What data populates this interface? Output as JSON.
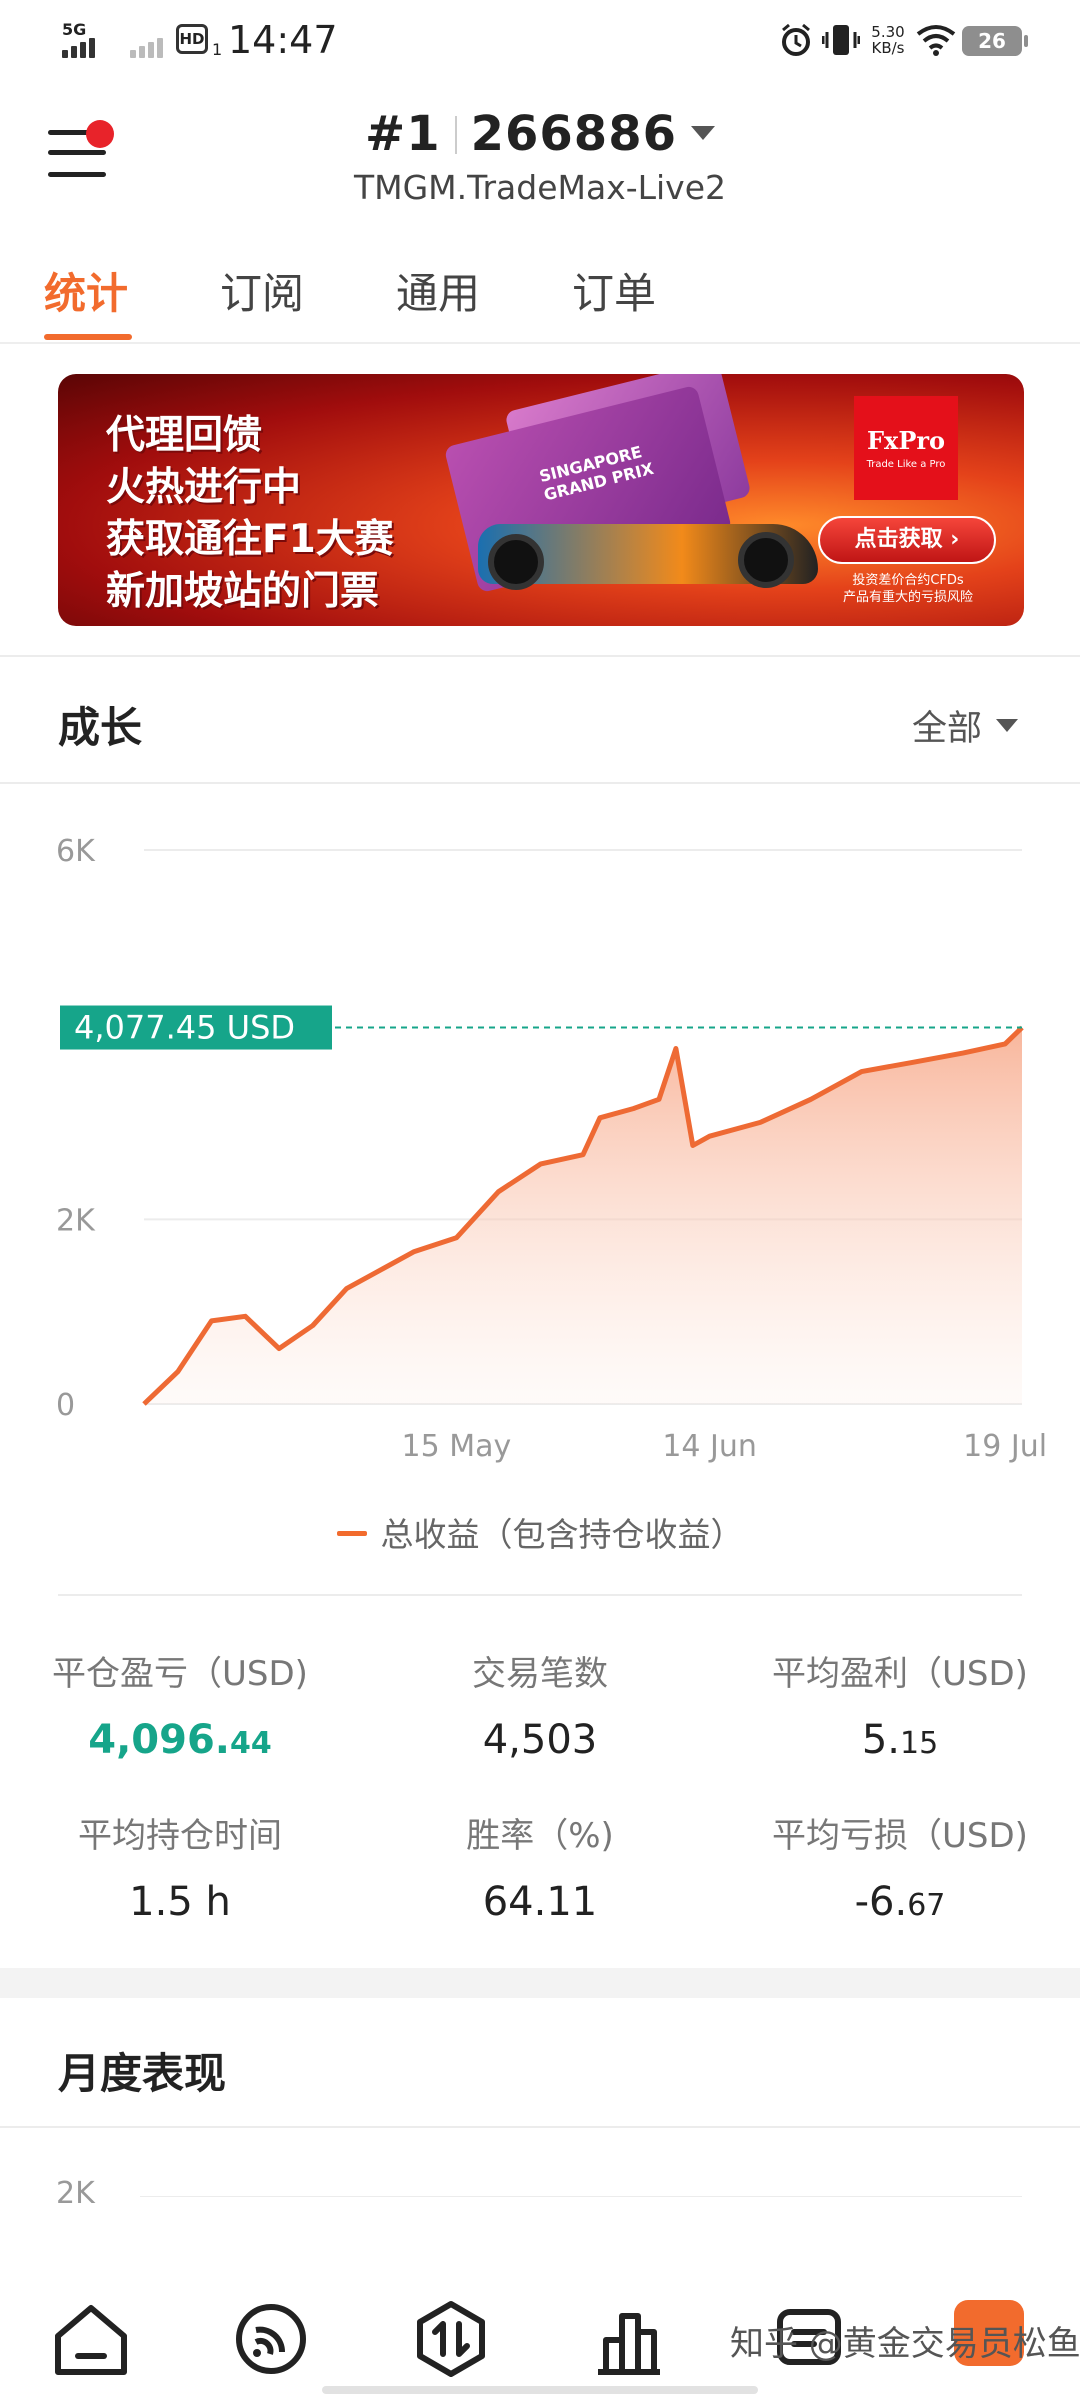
{
  "status_bar": {
    "network": "5G",
    "hd": "HD",
    "hd_sub": "1",
    "time": "14:47",
    "net_speed_value": "5.30",
    "net_speed_unit": "KB/s",
    "battery": "26"
  },
  "header": {
    "rank": "#1",
    "account_id": "266886",
    "server": "TMGM.TradeMax-Live2"
  },
  "tabs": [
    "统计",
    "订阅",
    "通用",
    "订单"
  ],
  "banner": {
    "lines": [
      "代理回馈",
      "火热进行中",
      "获取通往F1大赛",
      "新加坡站的门票"
    ],
    "brand": "FxPro",
    "brand_tagline": "Trade Like a Pro",
    "ticket_text": "SINGAPORE GRAND PRIX",
    "cta": "点击获取",
    "disclaimer_1": "投资差价合约CFDs",
    "disclaimer_2": "产品有重大的亏损风险"
  },
  "growth": {
    "title": "成长",
    "range": "全部",
    "current_value_label": "4,077.45  USD",
    "legend": "总收益（包含持仓收益）"
  },
  "chart_data": {
    "type": "area",
    "y_ticks": [
      "0",
      "2K",
      "6K"
    ],
    "x_ticks": [
      "15  May",
      "14  Jun",
      "19  Jul"
    ],
    "ylim": [
      0,
      6000
    ],
    "current_value": 4077.45,
    "x": [
      "Apr 8",
      "Apr 12",
      "Apr 16",
      "Apr 20",
      "Apr 24",
      "Apr 28",
      "May 2",
      "May 6",
      "May 10",
      "May 15",
      "May 20",
      "May 25",
      "May 30",
      "Jun 1",
      "Jun 5",
      "Jun 8",
      "Jun 10",
      "Jun 12",
      "Jun 14",
      "Jun 20",
      "Jun 26",
      "Jul 2",
      "Jul 8",
      "Jul 14",
      "Jul 19",
      "Jul 21"
    ],
    "series": [
      {
        "values": [
          0,
          350,
          900,
          950,
          600,
          850,
          1250,
          1450,
          1650,
          1800,
          2300,
          2600,
          2700,
          3100,
          3200,
          3300,
          3850,
          2800,
          2900,
          3050,
          3300,
          3600,
          3700,
          3800,
          3900,
          4077
        ]
      }
    ]
  },
  "stats": [
    {
      "label": "平仓盈亏（USD)",
      "value_main": "4,096.",
      "value_dec": "44",
      "style": "green"
    },
    {
      "label": "交易笔数",
      "value_main": "4,503",
      "value_dec": "",
      "style": "normal"
    },
    {
      "label": "平均盈利（USD)",
      "value_main": "5.",
      "value_dec": "15",
      "style": "normal"
    },
    {
      "label": "平均持仓时间",
      "value_main": "1.5 h",
      "value_dec": "",
      "style": "normal"
    },
    {
      "label": "胜率（%)",
      "value_main": "64.11",
      "value_dec": "",
      "style": "normal"
    },
    {
      "label": "平均亏损（USD)",
      "value_main": "-6.",
      "value_dec": "67",
      "style": "normal"
    }
  ],
  "monthly": {
    "title": "月度表现",
    "y_tick": "2K"
  },
  "bottom_nav": [
    "home-icon",
    "subscription-icon",
    "trade-icon",
    "chart-icon",
    "message-icon",
    "profile-icon"
  ],
  "watermark": "知乎 @黄金交易员松鱼",
  "colors": {
    "accent": "#f26b2d",
    "positive": "#16a58a",
    "badge": "#e8232a"
  }
}
